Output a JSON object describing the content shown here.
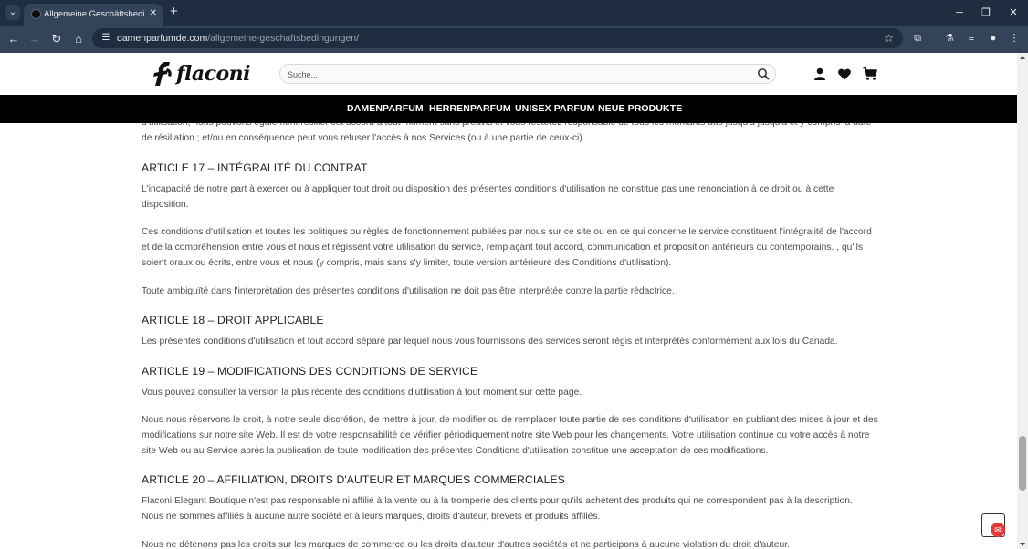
{
  "browser": {
    "tab_title": "Allgemeine Geschäftsbedingungen",
    "url_host": "damenparfumde.com",
    "url_path": "/allgemeine-geschaftsbedingungen/"
  },
  "site": {
    "logo_text": "flaconi",
    "search_placeholder": "Suche...",
    "nav": [
      "DAMENPARFUM",
      "HERRENPARFUM",
      "UNISEX PARFUM",
      "NEUE PRODUKTE"
    ]
  },
  "content": {
    "p_top": "d'utilisation, nous pouvons également résilier cet accord à tout moment sans préavis et vous resterez responsable de tous les montants dus jusqu'à jusqu'à et y compris la date de résiliation ; et/ou en conséquence peut vous refuser l'accès à nos Services (ou à une partie de ceux-ci).",
    "h17": "ARTICLE 17 – INTÉGRALITÉ DU CONTRAT",
    "p17_1": "L'incapacité de notre part à exercer ou à appliquer tout droit ou disposition des présentes conditions d'utilisation ne constitue pas une renonciation à ce droit ou à cette disposition.",
    "p17_2": "Ces conditions d'utilisation et toutes les politiques ou règles de fonctionnement publiées par nous sur ce site ou en ce qui concerne le service constituent l'intégralité de l'accord et de la compréhension entre vous et nous et régissent votre utilisation du service, remplaçant tout accord, communication et proposition antérieurs ou contemporains. , qu'ils soient oraux ou écrits, entre vous et nous (y compris, mais sans s'y limiter, toute version antérieure des Conditions d'utilisation).",
    "p17_3": "Toute ambiguïté dans l'interprétation des présentes conditions d'utilisation ne doit pas être interprétée contre la partie rédactrice.",
    "h18": "ARTICLE 18 – DROIT APPLICABLE",
    "p18_1": "Les présentes conditions d'utilisation et tout accord séparé par lequel nous vous fournissons des services seront régis et interprétés conformément aux lois du Canada.",
    "h19": "ARTICLE 19 – MODIFICATIONS DES CONDITIONS DE SERVICE",
    "p19_1": "Vous pouvez consulter la version la plus récente des conditions d'utilisation à tout moment sur cette page.",
    "p19_2": "Nous nous réservons le droit, à notre seule discrétion, de mettre à jour, de modifier ou de remplacer toute partie de ces conditions d'utilisation en publiant des mises à jour et des modifications sur notre site Web. Il est de votre responsabilité de vérifier périodiquement notre site Web pour les changements. Votre utilisation continue ou votre accès à notre site Web ou au Service après la publication de toute modification des présentes Conditions d'utilisation constitue une acceptation de ces modifications.",
    "h20": "ARTICLE 20 – AFFILIATION, DROITS D'AUTEUR ET MARQUES COMMERCIALES",
    "p20_1a": "Flaconi Elegant Boutique n'est pas responsable ni affilié à la vente ou à la tromperie des clients pour qu'ils achètent des produits qui ne correspondent pas à la description.",
    "p20_1b": "Nous ne sommes affiliés à aucune autre société et à leurs marques, droits d'auteur, brevets et produits affiliés.",
    "p20_2": "Nous ne détenons pas les droits sur les marques de commerce ou les droits d'auteur d'autres sociétés et ne participons à aucune violation du droit d'auteur."
  },
  "colors": {
    "chrome_dark": "#1f2d41",
    "chrome_toolbar": "#33435a",
    "nav_bg": "#000000",
    "text": "#4d4d4d",
    "heading": "#222222",
    "badge": "#e5393a"
  },
  "icons": [
    "tab-search-icon",
    "close-icon",
    "plus-icon",
    "back-icon",
    "forward-icon",
    "reload-icon",
    "home-icon",
    "site-info-icon",
    "bookmark-star-icon",
    "extensions-icon",
    "labs-icon",
    "media-icon",
    "profile-icon",
    "menu-icon",
    "search-icon",
    "user-icon",
    "heart-icon",
    "cart-icon",
    "chat-widget-icon"
  ]
}
